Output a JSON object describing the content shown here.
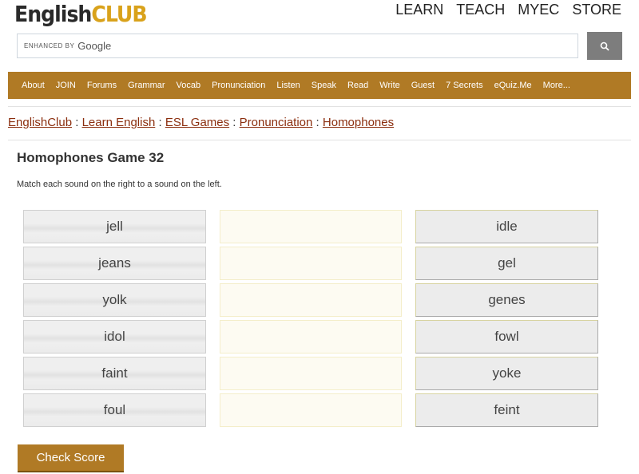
{
  "logo": {
    "part1": "English",
    "part2": "CLUB"
  },
  "topnav": [
    "LEARN",
    "TEACH",
    "MYEC",
    "STORE"
  ],
  "search": {
    "enhanced": "ENHANCED BY",
    "google": "Google",
    "button_icon": "search-icon"
  },
  "menu": [
    "About",
    "JOIN",
    "Forums",
    "Grammar",
    "Vocab",
    "Pronunciation",
    "Listen",
    "Speak",
    "Read",
    "Write",
    "Guest",
    "7 Secrets",
    "eQuiz.Me",
    "More..."
  ],
  "breadcrumb": [
    "EnglishClub",
    "Learn English",
    "ESL Games",
    "Pronunciation",
    "Homophones"
  ],
  "breadcrumb_sep": " : ",
  "title": "Homophones Game 32",
  "instructions": "Match each sound on the right to a sound on the left.",
  "left_words": [
    "jell",
    "jeans",
    "yolk",
    "idol",
    "faint",
    "foul"
  ],
  "right_words": [
    "idle",
    "gel",
    "genes",
    "fowl",
    "yoke",
    "feint"
  ],
  "check_button": "Check Score",
  "colors": {
    "brand": "#b07a25",
    "link": "#8b2e0e"
  }
}
